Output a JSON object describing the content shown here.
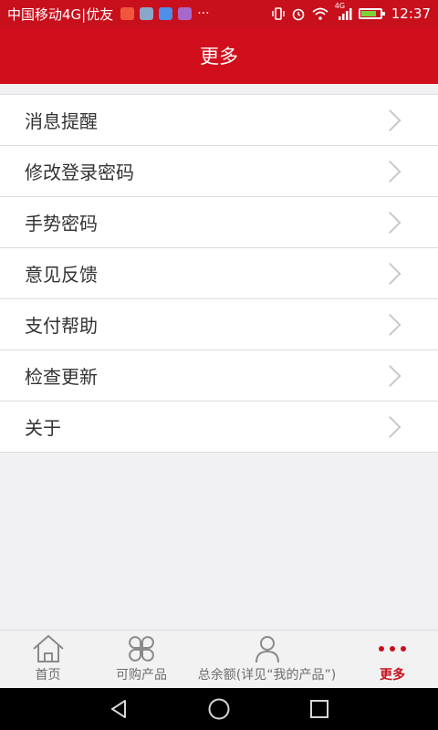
{
  "status_bar": {
    "carrier": "中国移动4G|优友",
    "more": "···",
    "network": "4G",
    "battery_level": 0.9,
    "time": "12:37",
    "colors": {
      "background": "#c8101d"
    }
  },
  "header": {
    "title": "更多"
  },
  "menu": {
    "items": [
      {
        "label": "消息提醒"
      },
      {
        "label": "修改登录密码"
      },
      {
        "label": "手势密码"
      },
      {
        "label": "意见反馈"
      },
      {
        "label": "支付帮助"
      },
      {
        "label": "检查更新"
      },
      {
        "label": "关于"
      }
    ]
  },
  "tabbar": {
    "tabs": [
      {
        "label": "首页",
        "icon": "home-icon"
      },
      {
        "label": "可购产品",
        "icon": "clover-icon"
      },
      {
        "label": "总余额(详见“我的产品”)",
        "icon": "person-icon"
      },
      {
        "label": "更多",
        "icon": "more-dots-icon",
        "active": true
      }
    ],
    "active_color": "#c8101d"
  },
  "system_nav": {
    "buttons": [
      "back-icon",
      "home-circle-icon",
      "recents-icon"
    ]
  }
}
